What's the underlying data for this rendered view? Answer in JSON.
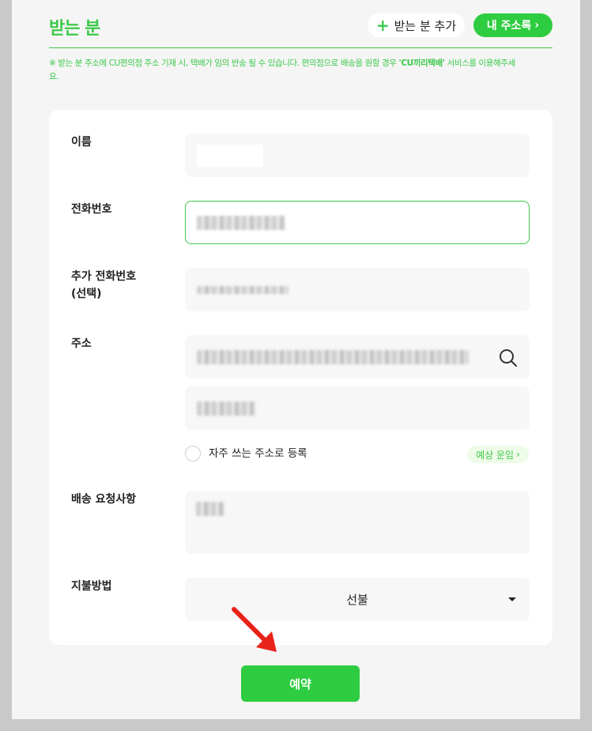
{
  "header": {
    "title": "받는 분",
    "add_recipient_label": "받는 분 추가",
    "address_book_label": "내 주소록"
  },
  "notice": {
    "text_before": "※ 받는 분 주소에 CU편의점 주소 기재 시, 택배가 임의 반송 될 수 있습니다. 편의점으로 배송을 원할 경우 ",
    "emphasis": "'CU끼리택배'",
    "text_after": " 서비스를 이용해주세요."
  },
  "form": {
    "name_label": "이름",
    "phone_label": "전화번호",
    "extra_phone_label_line1": "추가 전화번호",
    "extra_phone_label_line2": "(선택)",
    "address_label": "주소",
    "save_address_label": "자주 쓰는 주소로 등록",
    "expected_shipping_label": "예상 운임",
    "request_label": "배송 요청사항",
    "payment_label": "지불방법",
    "payment_value": "선불"
  },
  "submit_label": "예약",
  "colors": {
    "accent": "#2ecc40",
    "accent_text": "#3cc94a",
    "arrow": "#e8231a"
  },
  "icons": [
    "plus-icon",
    "chevron-right-icon",
    "search-icon",
    "dropdown-arrow-icon",
    "red-arrow-annotation"
  ]
}
